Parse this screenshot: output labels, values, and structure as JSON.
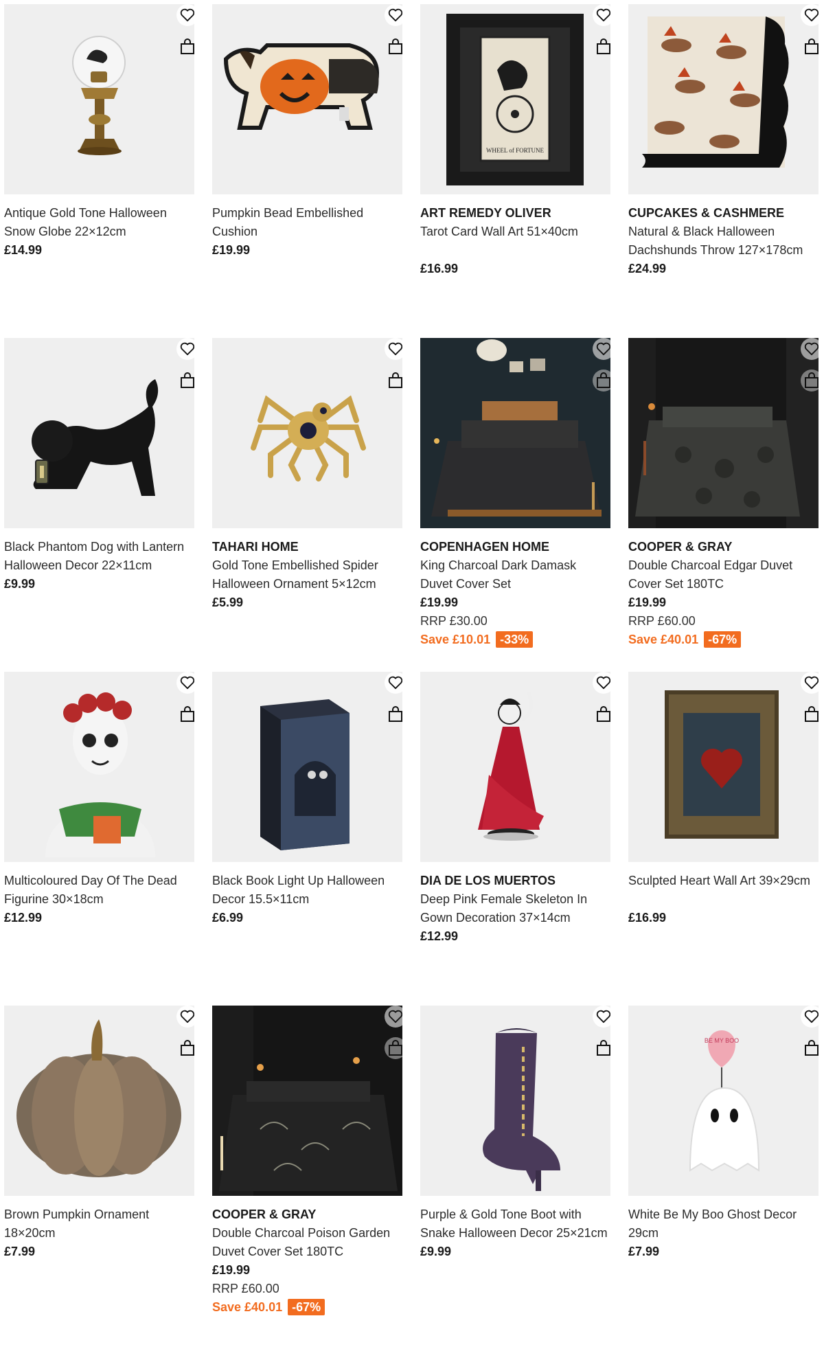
{
  "products": [
    {
      "brand": "",
      "name": "Antique Gold Tone Halloween Snow Globe 22×12cm",
      "price": "£14.99",
      "rrp": "",
      "save": "",
      "pct": "",
      "icon": "snow-globe"
    },
    {
      "brand": "",
      "name": "Pumpkin Bead Embellished Cushion",
      "price": "£19.99",
      "rrp": "",
      "save": "",
      "pct": "",
      "icon": "dog-cushion"
    },
    {
      "brand": "ART REMEDY OLIVER",
      "name": "Tarot Card Wall Art 51×40cm",
      "price": "£16.99",
      "rrp": "",
      "save": "",
      "pct": "",
      "icon": "tarot-art"
    },
    {
      "brand": "CUPCAKES & CASHMERE",
      "name": "Natural & Black Halloween Dachshunds Throw 127×178cm",
      "price": "£24.99",
      "rrp": "",
      "save": "",
      "pct": "",
      "icon": "throw"
    },
    {
      "brand": "",
      "name": "Black Phantom Dog with Lantern Halloween Decor 22×11cm",
      "price": "£9.99",
      "rrp": "",
      "save": "",
      "pct": "",
      "icon": "phantom-dog"
    },
    {
      "brand": "TAHARI HOME",
      "name": "Gold Tone Embellished Spider Halloween Ornament 5×12cm",
      "price": "£5.99",
      "rrp": "",
      "save": "",
      "pct": "",
      "icon": "spider"
    },
    {
      "brand": "COPENHAGEN HOME",
      "name": "King Charcoal Dark Damask Duvet Cover Set",
      "price": "£19.99",
      "rrp": "RRP £30.00",
      "save": "Save £10.01",
      "pct": "-33%",
      "icon": "bed"
    },
    {
      "brand": "COOPER & GRAY",
      "name": "Double Charcoal Edgar Duvet Cover Set 180TC",
      "price": "£19.99",
      "rrp": "RRP £60.00",
      "save": "Save £40.01",
      "pct": "-67%",
      "icon": "bed"
    },
    {
      "brand": "",
      "name": "Multicoloured Day Of The Dead Figurine 30×18cm",
      "price": "£12.99",
      "rrp": "",
      "save": "",
      "pct": "",
      "icon": "figurine"
    },
    {
      "brand": "",
      "name": "Black Book Light Up Halloween Decor 15.5×11cm",
      "price": "£6.99",
      "rrp": "",
      "save": "",
      "pct": "",
      "icon": "book"
    },
    {
      "brand": "DIA DE LOS MUERTOS",
      "name": "Deep Pink Female Skeleton In Gown Decoration 37×14cm",
      "price": "£12.99",
      "rrp": "",
      "save": "",
      "pct": "",
      "icon": "skeleton"
    },
    {
      "brand": "",
      "name": "Sculpted Heart Wall Art 39×29cm",
      "price": "£16.99",
      "rrp": "",
      "save": "",
      "pct": "",
      "icon": "heart-frame"
    },
    {
      "brand": "",
      "name": "Brown Pumpkin Ornament 18×20cm",
      "price": "£7.99",
      "rrp": "",
      "save": "",
      "pct": "",
      "icon": "pumpkin"
    },
    {
      "brand": "COOPER & GRAY",
      "name": "Double Charcoal Poison Garden Duvet Cover Set 180TC",
      "price": "£19.99",
      "rrp": "RRP £60.00",
      "save": "Save £40.01",
      "pct": "-67%",
      "icon": "bed"
    },
    {
      "brand": "",
      "name": "Purple & Gold Tone Boot with Snake Halloween Decor 25×21cm",
      "price": "£9.99",
      "rrp": "",
      "save": "",
      "pct": "",
      "icon": "boot"
    },
    {
      "brand": "",
      "name": "White Be My Boo Ghost Decor 29cm",
      "price": "£7.99",
      "rrp": "",
      "save": "",
      "pct": "",
      "icon": "ghost"
    }
  ],
  "ghost_balloon_text": "BE MY BOO",
  "tarot_caption": "WHEEL of FORTUNE",
  "colors": {
    "accent": "#f26c1f",
    "text": "#1a1a1a"
  }
}
